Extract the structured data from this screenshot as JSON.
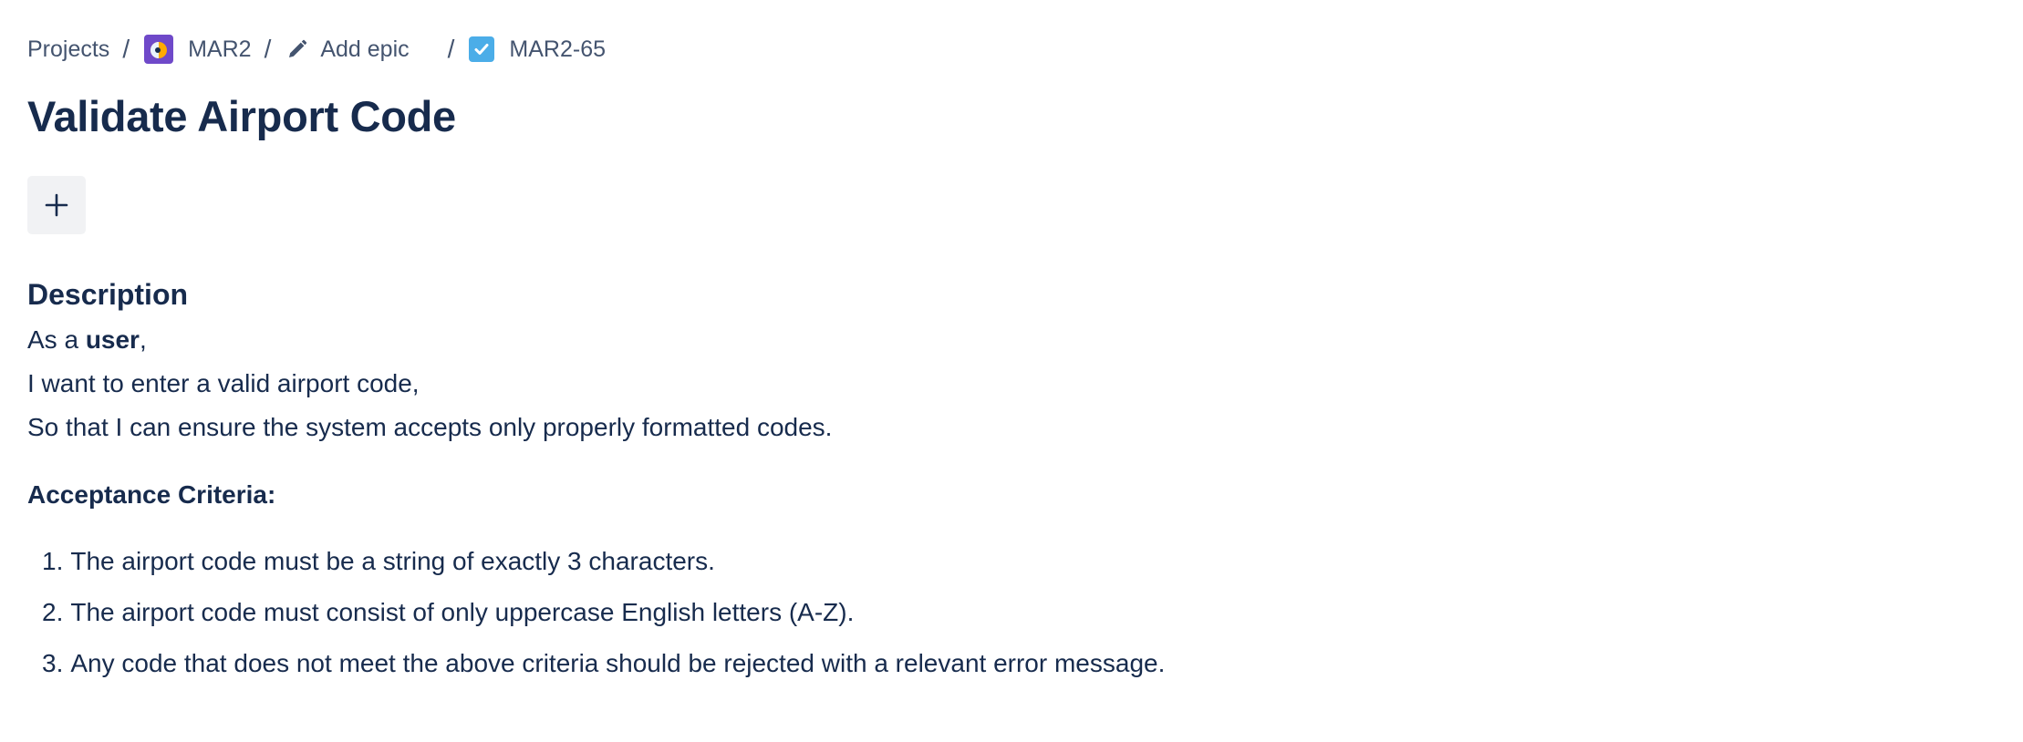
{
  "breadcrumb": {
    "projects_label": "Projects",
    "separator": "/",
    "project_key": "MAR2",
    "epic_label": "Add epic",
    "issue_key": "MAR2-65"
  },
  "issue": {
    "title": "Validate Airport Code",
    "add_button_icon": "plus-icon"
  },
  "description": {
    "heading": "Description",
    "line1_prefix": "As a ",
    "line1_bold": "user",
    "line1_suffix": ",",
    "line2": "I want to enter a valid airport code,",
    "line3": "So that I can ensure the system accepts only properly formatted codes.",
    "criteria_heading": "Acceptance Criteria:",
    "criteria": [
      {
        "num": "1.",
        "text": "The airport code must be a string of exactly 3 characters."
      },
      {
        "num": "2.",
        "text": "The airport code must consist of only uppercase English letters (A-Z)."
      },
      {
        "num": "3.",
        "text": "Any code that does not meet the above criteria should be rejected with a relevant error message."
      }
    ]
  },
  "colors": {
    "text_primary": "#172b4d",
    "text_subtle": "#44546f",
    "task_icon": "#4bade8",
    "project_avatar": "#6f49c9",
    "button_bg": "#f1f2f4"
  }
}
